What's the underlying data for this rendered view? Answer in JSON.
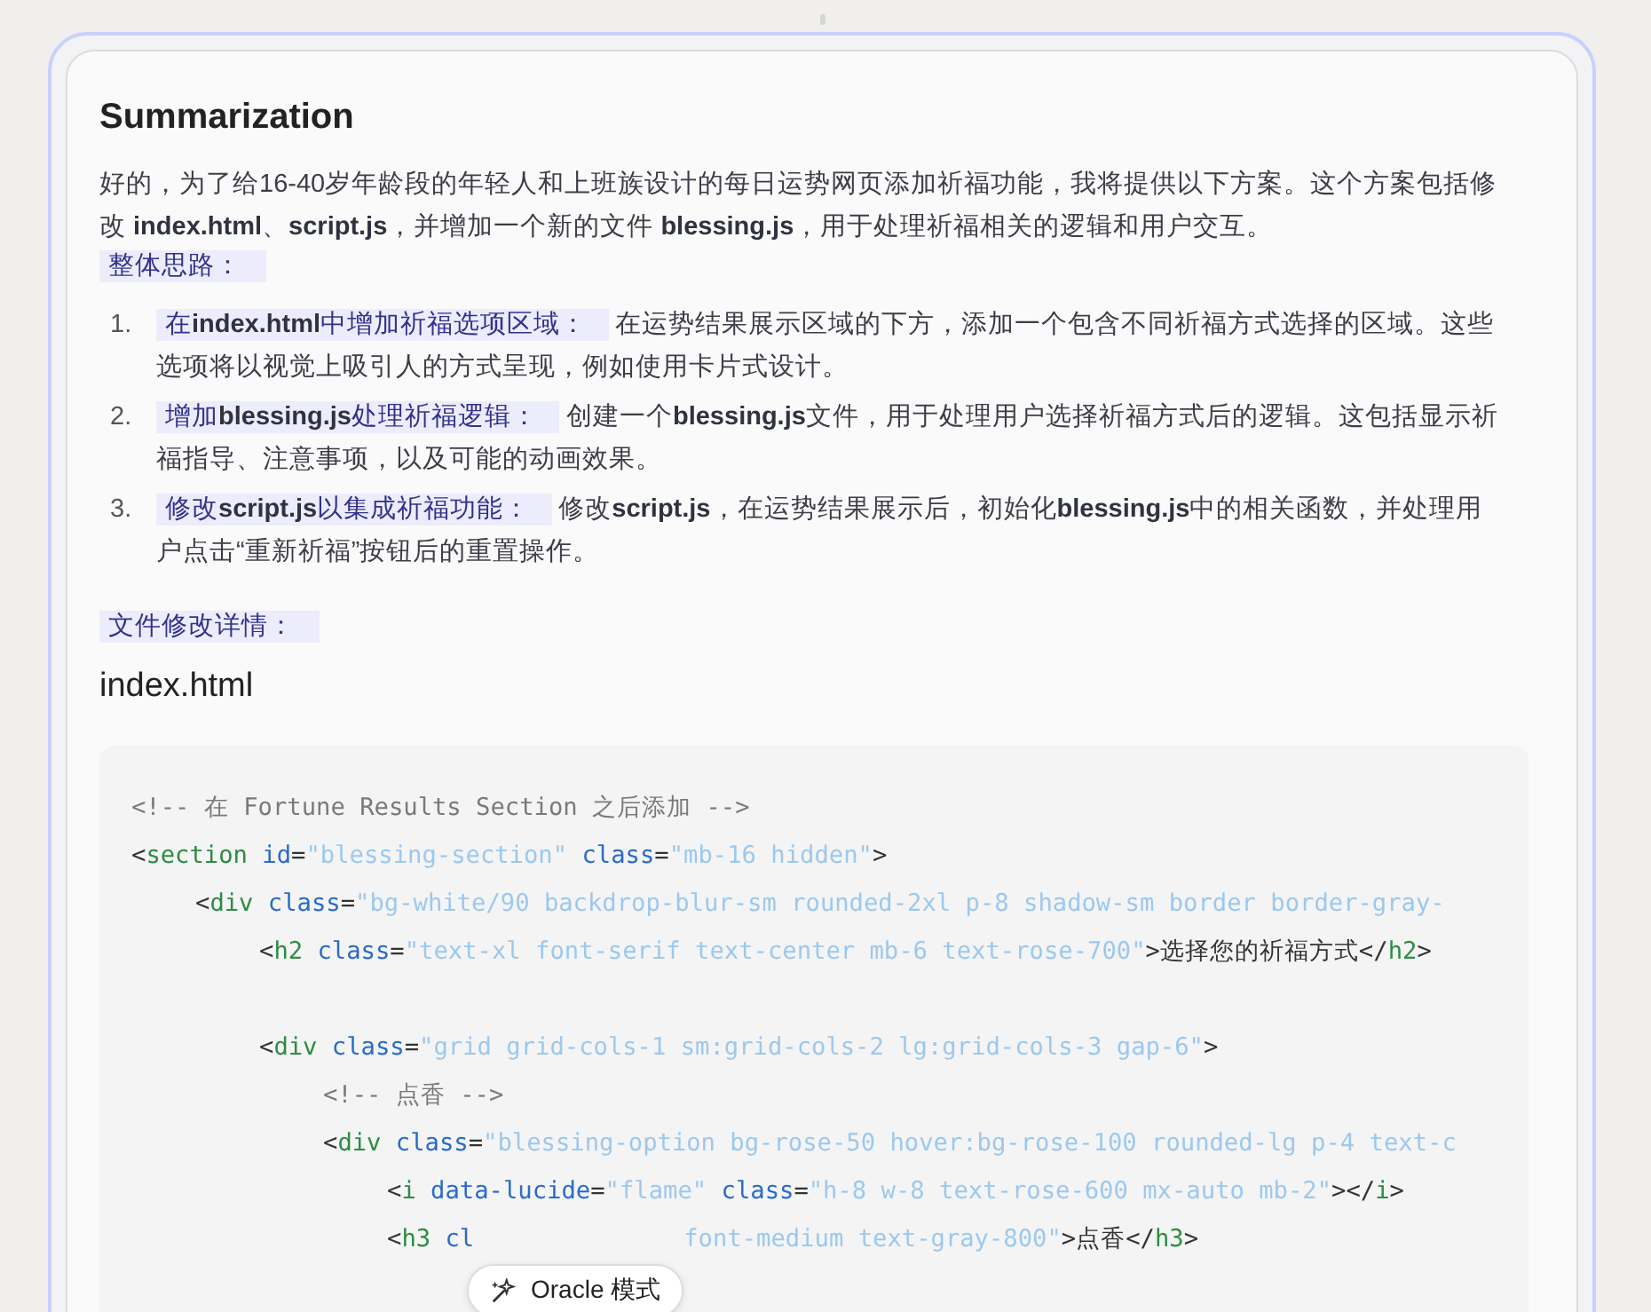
{
  "heading": "Summarization",
  "intro": "好的，为了给16-40岁年龄段的年轻人和上班族设计的每日运势网页添加祈福功能，我将提供以下方案。这个方案包括修改 **index.html**、**script.js**，并增加一个新的文件 **blessing.js**，用于处理祈福相关的逻辑和用户交互。",
  "approach_label": "整体思路：",
  "steps": [
    {
      "number": "1.",
      "label": "在**index.html**中增加祈福选项区域：",
      "text": "在运势结果展示区域的下方，添加一个包含不同祈福方式选择的区域。这些选项将以视觉上吸引人的方式呈现，例如使用卡片式设计。"
    },
    {
      "number": "2.",
      "label": "增加**blessing.js**处理祈福逻辑：",
      "text": "创建一个**blessing.js**文件，用于处理用户选择祈福方式后的逻辑。这包括显示祈福指导、注意事项，以及可能的动画效果。"
    },
    {
      "number": "3.",
      "label": "修改**script.js**以集成祈福功能：",
      "text": "修改**script.js**，在运势结果展示后，初始化**blessing.js**中的相关函数，并处理用户点击“重新祈福”按钮后的重置操作。"
    }
  ],
  "details_label": "文件修改详情：",
  "file_heading": "index.html",
  "code_lines": [
    {
      "kind": "code",
      "tokens": [
        {
          "kind": "comment",
          "text": "<!-- 在 Fortune Results Section 之后添加 -->"
        }
      ]
    },
    {
      "kind": "code",
      "tokens": [
        {
          "kind": "punct",
          "text": "<"
        },
        {
          "kind": "tag",
          "text": "section"
        },
        {
          "kind": "attr",
          "text": " id"
        },
        {
          "kind": "punct",
          "text": "="
        },
        {
          "kind": "str",
          "text": "\"blessing-section\""
        },
        {
          "kind": "attr",
          "text": " class"
        },
        {
          "kind": "punct",
          "text": "="
        },
        {
          "kind": "str",
          "text": "\"mb-16 hidden\""
        },
        {
          "kind": "punct",
          "text": ">"
        }
      ],
      "children": [
        {
          "kind": "code",
          "tokens": [
            {
              "kind": "punct",
              "text": "<"
            },
            {
              "kind": "tag",
              "text": "div"
            },
            {
              "kind": "attr",
              "text": " class"
            },
            {
              "kind": "punct",
              "text": "="
            },
            {
              "kind": "str",
              "text": "\"bg-white/90 backdrop-blur-sm rounded-2xl p-8 shadow-sm border border-gray-"
            }
          ],
          "children": [
            {
              "kind": "code",
              "tokens": [
                {
                  "kind": "punct",
                  "text": "<"
                },
                {
                  "kind": "tag",
                  "text": "h2"
                },
                {
                  "kind": "attr",
                  "text": " class"
                },
                {
                  "kind": "punct",
                  "text": "="
                },
                {
                  "kind": "str",
                  "text": "\"text-xl font-serif text-center mb-6 text-rose-700\""
                },
                {
                  "kind": "punct",
                  "text": ">选择您的祈福方式</"
                },
                {
                  "kind": "tag",
                  "text": "h2"
                },
                {
                  "kind": "punct",
                  "text": ">"
                }
              ]
            },
            {
              "kind": "blank"
            },
            {
              "kind": "code",
              "tokens": [
                {
                  "kind": "punct",
                  "text": "<"
                },
                {
                  "kind": "tag",
                  "text": "div"
                },
                {
                  "kind": "attr",
                  "text": " class"
                },
                {
                  "kind": "punct",
                  "text": "="
                },
                {
                  "kind": "str",
                  "text": "\"grid grid-cols-1 sm:grid-cols-2 lg:grid-cols-3 gap-6\""
                },
                {
                  "kind": "punct",
                  "text": ">"
                }
              ],
              "children": [
                {
                  "kind": "code",
                  "tokens": [
                    {
                      "kind": "comment",
                      "text": "<!-- 点香 -->"
                    }
                  ]
                },
                {
                  "kind": "code",
                  "tokens": [
                    {
                      "kind": "punct",
                      "text": "<"
                    },
                    {
                      "kind": "tag",
                      "text": "div"
                    },
                    {
                      "kind": "attr",
                      "text": " class"
                    },
                    {
                      "kind": "punct",
                      "text": "="
                    },
                    {
                      "kind": "str",
                      "text": "\"blessing-option bg-rose-50 hover:bg-rose-100 rounded-lg p-4 text-c"
                    }
                  ],
                  "children": [
                    {
                      "kind": "code",
                      "tokens": [
                        {
                          "kind": "punct",
                          "text": "<"
                        },
                        {
                          "kind": "tag",
                          "text": "i"
                        },
                        {
                          "kind": "attr",
                          "text": " data-lucide"
                        },
                        {
                          "kind": "punct",
                          "text": "="
                        },
                        {
                          "kind": "str",
                          "text": "\"flame\""
                        },
                        {
                          "kind": "attr",
                          "text": " class"
                        },
                        {
                          "kind": "punct",
                          "text": "="
                        },
                        {
                          "kind": "str",
                          "text": "\"h-8 w-8 text-rose-600 mx-auto mb-2\""
                        },
                        {
                          "kind": "punct",
                          "text": "></"
                        },
                        {
                          "kind": "tag",
                          "text": "i"
                        },
                        {
                          "kind": "punct",
                          "text": ">"
                        }
                      ]
                    },
                    {
                      "kind": "code",
                      "tokens": [
                        {
                          "kind": "punct",
                          "text": "<"
                        },
                        {
                          "kind": "tag",
                          "text": "h3"
                        },
                        {
                          "kind": "attr",
                          "text": " cl"
                        },
                        {
                          "kind": "str_after_cover",
                          "text": "font-medium text-gray-800\""
                        },
                        {
                          "kind": "punct",
                          "text": ">点香</"
                        },
                        {
                          "kind": "tag",
                          "text": "h3"
                        },
                        {
                          "kind": "punct",
                          "text": ">"
                        }
                      ]
                    }
                  ]
                }
              ]
            }
          ]
        }
      ]
    }
  ],
  "floating_button": {
    "label": "Oracle 模式"
  }
}
